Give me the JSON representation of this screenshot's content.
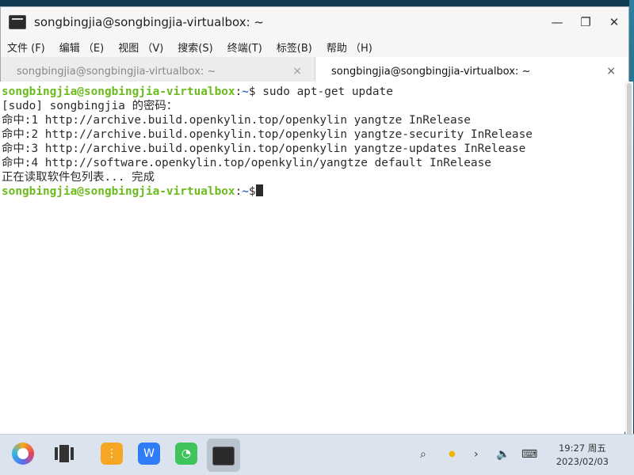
{
  "window": {
    "title": "songbingjia@songbingjia-virtualbox: ~",
    "controls": {
      "minimize": "—",
      "restore": "❐",
      "close": "✕"
    }
  },
  "menubar": {
    "items": [
      "文件 (F)",
      "编辑 （E)",
      "视图 （V)",
      "搜索(S)",
      "终端(T)",
      "标签(B)",
      "帮助 （H)"
    ]
  },
  "tabs": [
    {
      "label": "songbingjia@songbingjia-virtualbox: ~",
      "close": "×",
      "active": false
    },
    {
      "label": "songbingjia@songbingjia-virtualbox: ~",
      "close": "×",
      "active": true
    }
  ],
  "terminal": {
    "prompt": {
      "user_host": "songbingjia@songbingjia-virtualbox",
      "sep": ":",
      "path": "~",
      "symbol": "$"
    },
    "command": " sudo apt-get update",
    "output": [
      "[sudo] songbingjia 的密码：",
      "命中:1 http://archive.build.openkylin.top/openkylin yangtze InRelease",
      "命中:2 http://archive.build.openkylin.top/openkylin yangtze-security InRelease",
      "命中:3 http://archive.build.openkylin.top/openkylin yangtze-updates InRelease",
      "命中:4 http://software.openkylin.top/openkylin/yangtze default InRelease",
      "正在读取软件包列表... 完成"
    ],
    "colors": {
      "user_host": "#6cbb1e",
      "path": "#3b6bd0",
      "text": "#2b2b2b"
    }
  },
  "taskbar": {
    "apps": [
      "start-menu-icon",
      "multitask-view-icon",
      "file-manager-icon",
      "wps-icon",
      "wechat-icon",
      "terminal-icon"
    ],
    "tray": {
      "search": "⌕",
      "notify": "●",
      "expand": "›",
      "volume": "🔈",
      "keyboard": "⌨"
    },
    "clock": {
      "time": "19:27 周五",
      "date": "2023/02/03"
    }
  }
}
